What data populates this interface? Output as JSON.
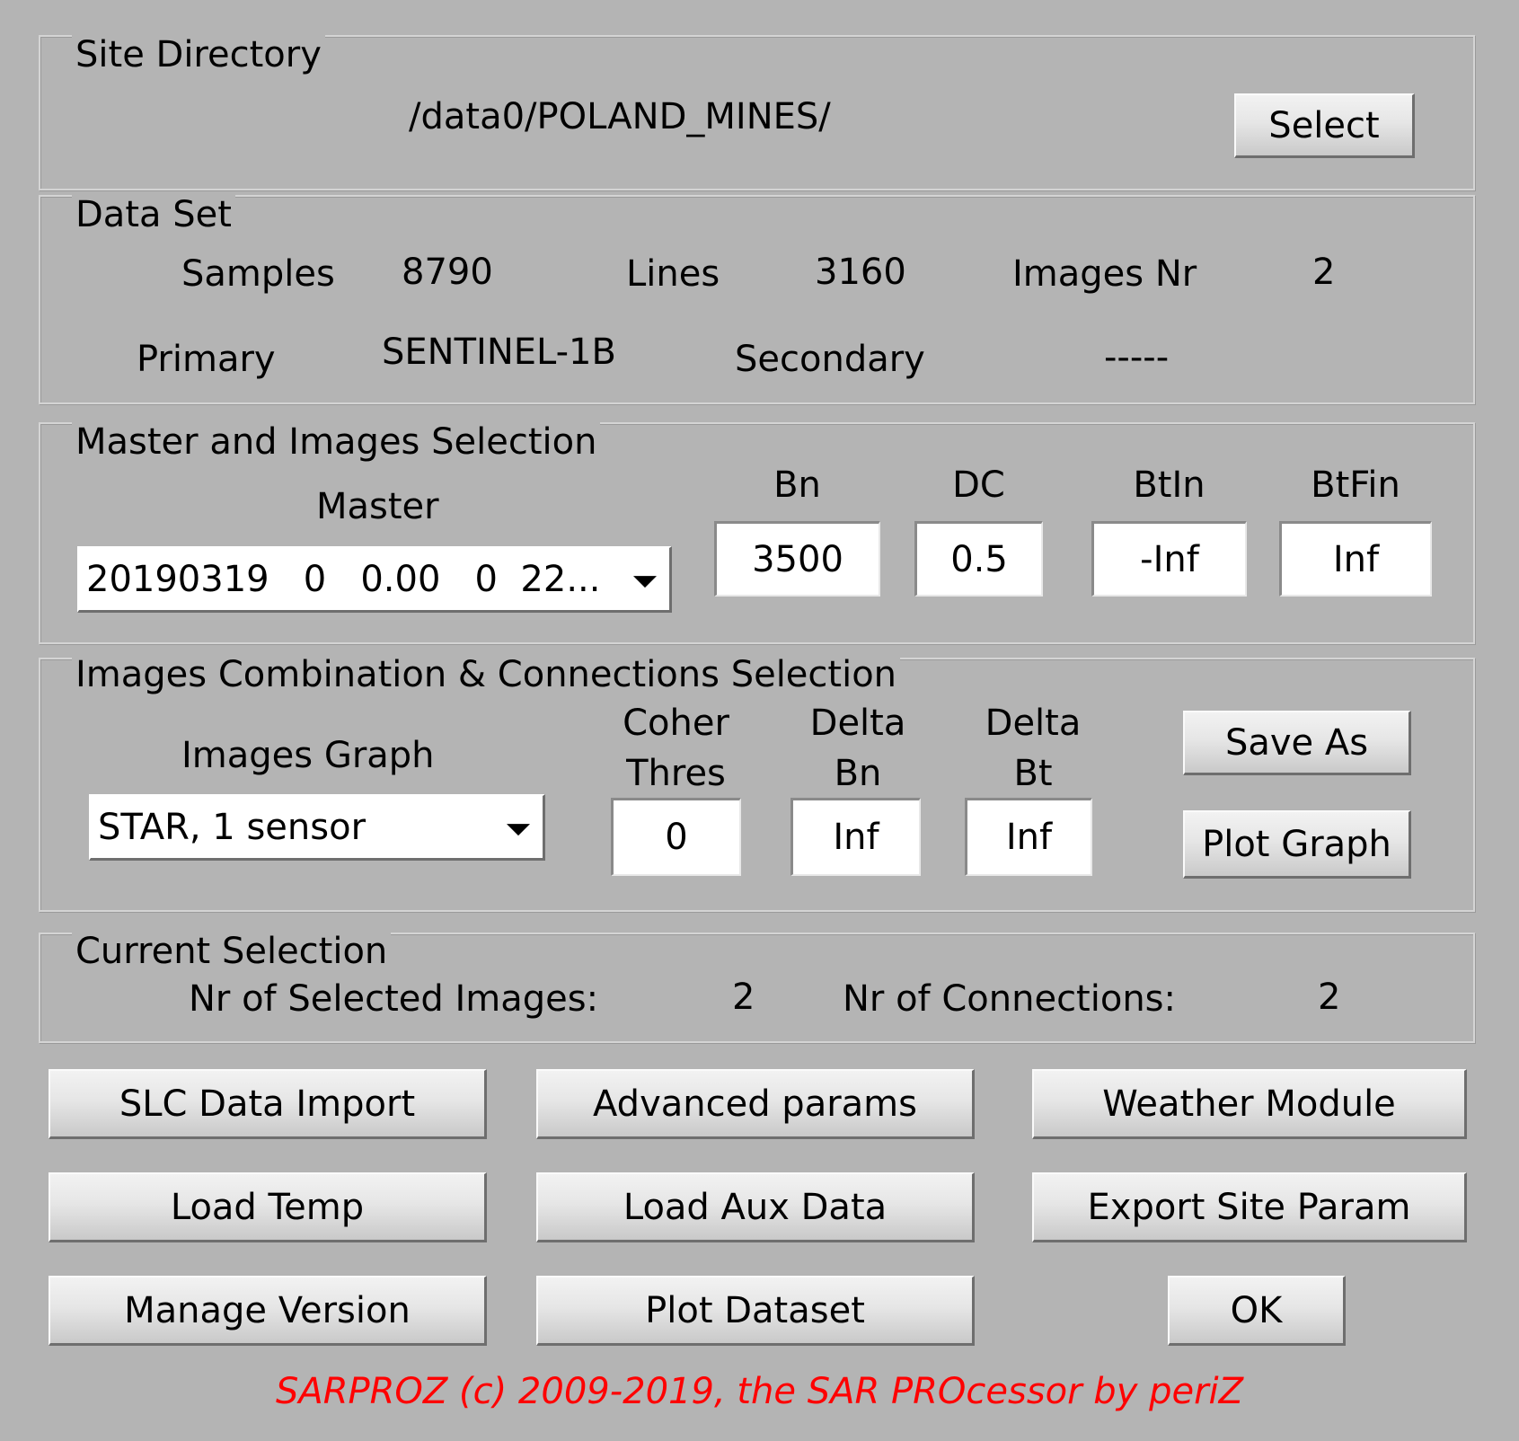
{
  "site_directory": {
    "title": "Site Directory",
    "path": "/data0/POLAND_MINES/",
    "select_label": "Select"
  },
  "data_set": {
    "title": "Data Set",
    "samples_label": "Samples",
    "samples_value": "8790",
    "lines_label": "Lines",
    "lines_value": "3160",
    "images_nr_label": "Images Nr",
    "images_nr_value": "2",
    "primary_label": "Primary",
    "primary_value": "SENTINEL-1B",
    "secondary_label": "Secondary",
    "secondary_value": "-----"
  },
  "master_selection": {
    "title": "Master and Images Selection",
    "master_label": "Master",
    "master_value": "20190319   0   0.00   0  22...",
    "bn_label": "Bn",
    "bn_value": "3500",
    "dc_label": "DC",
    "dc_value": "0.5",
    "btin_label": "BtIn",
    "btin_value": "-Inf",
    "btfin_label": "BtFin",
    "btfin_value": "Inf"
  },
  "combination": {
    "title": "Images Combination & Connections Selection",
    "graph_label": "Images Graph",
    "graph_value": "STAR, 1 sensor",
    "coher_label_1": "Coher",
    "coher_label_2": "Thres",
    "coher_value": "0",
    "delta_bn_label_1": "Delta",
    "delta_bn_label_2": "Bn",
    "delta_bn_value": "Inf",
    "delta_bt_label_1": "Delta",
    "delta_bt_label_2": "Bt",
    "delta_bt_value": "Inf",
    "save_as_label": "Save As",
    "plot_graph_label": "Plot Graph"
  },
  "current_selection": {
    "title": "Current Selection",
    "selected_images_label": "Nr of Selected Images:",
    "selected_images_value": "2",
    "connections_label": "Nr of Connections:",
    "connections_value": "2"
  },
  "buttons": {
    "slc_import": "SLC Data Import",
    "advanced_params": "Advanced params",
    "weather_module": "Weather Module",
    "load_temp": "Load Temp",
    "load_aux": "Load Aux Data",
    "export_site": "Export Site Param",
    "manage_version": "Manage Version",
    "plot_dataset": "Plot Dataset",
    "ok": "OK"
  },
  "footer": "SARPROZ (c) 2009-2019, the SAR PROcessor by periZ",
  "colors": {
    "background": "#b4b4b4",
    "footer_text": "#ff0000"
  }
}
